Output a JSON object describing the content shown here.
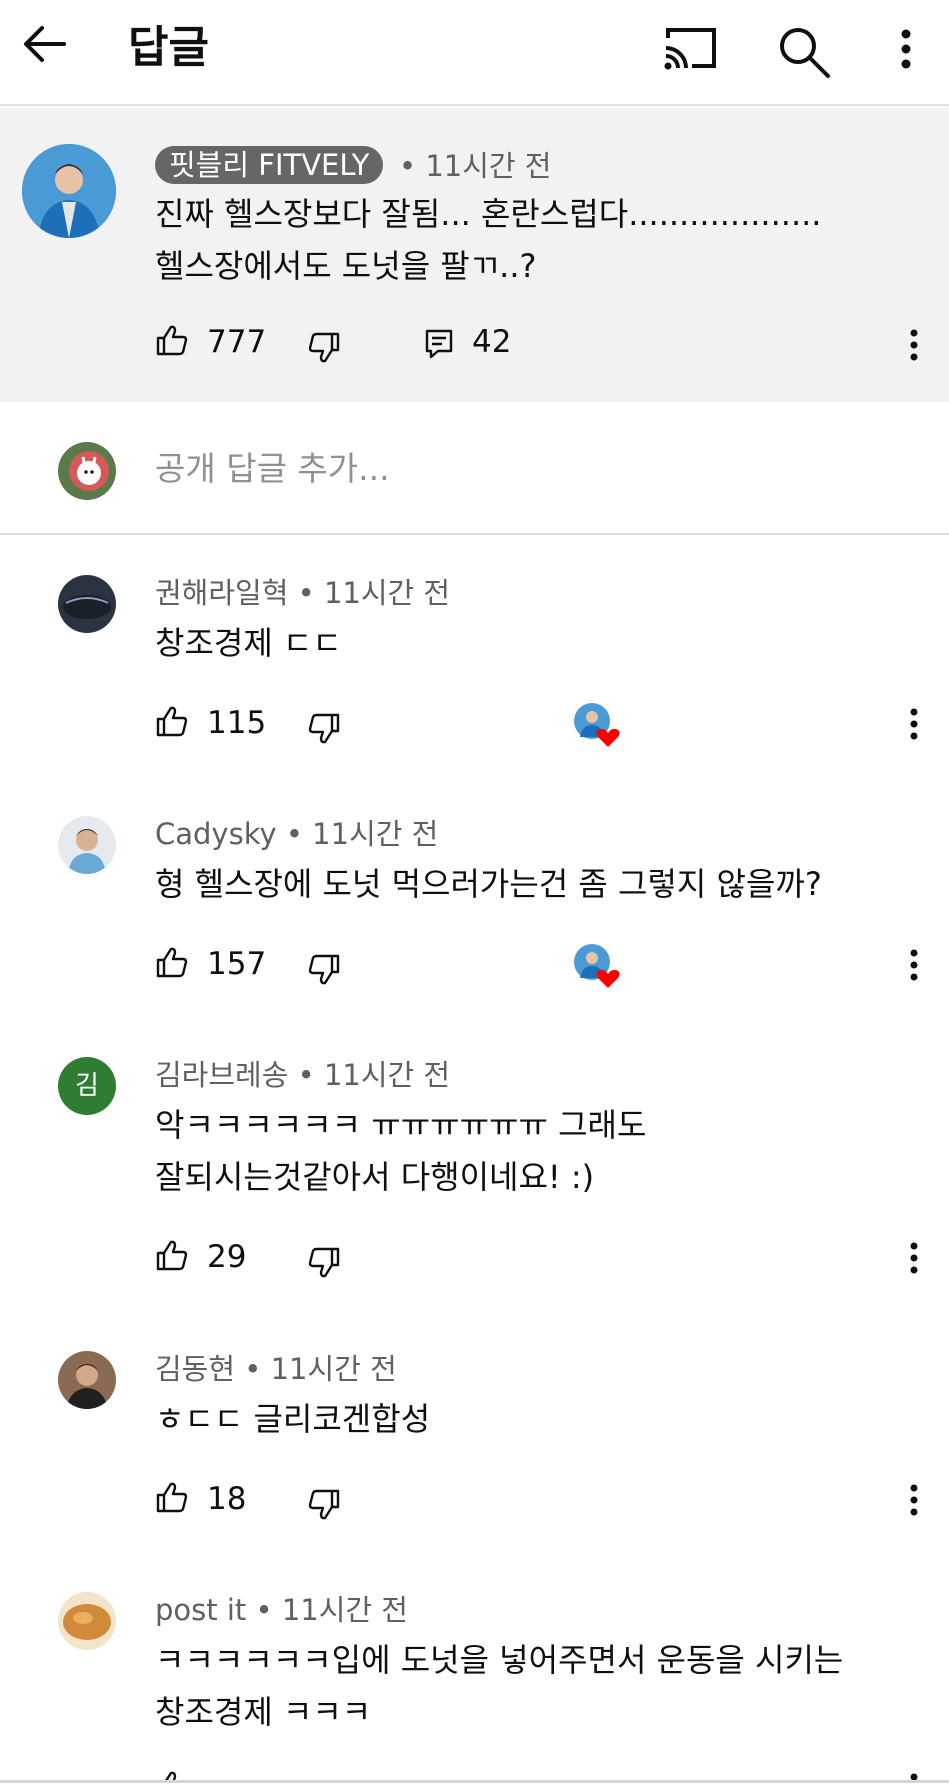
{
  "header": {
    "title": "답글"
  },
  "parent": {
    "author": "핏블리 FITVELY",
    "time": "• 11시간 전",
    "lines": [
      "진짜 헬스장보다 잘됨... 혼란스럽다...................",
      "헬스장에서도 도넛을 팔ㄲ..?"
    ],
    "likes": "777",
    "replies": "42"
  },
  "composer": {
    "placeholder": "공개 답글 추가..."
  },
  "comments": [
    {
      "author": "권해라일혁",
      "time": "• 11시간 전",
      "lines": [
        "창조경제 ㄷㄷ"
      ],
      "likes": "115",
      "hearted": true
    },
    {
      "author": "Cadysky",
      "time": "• 11시간 전",
      "lines": [
        "형 헬스장에 도넛 먹으러가는건 좀 그렇지 않을까?"
      ],
      "likes": "157",
      "hearted": true
    },
    {
      "author": "김라브레송",
      "time": "• 11시간 전",
      "lines": [
        "악ㅋㅋㅋㅋㅋㅋ ㅠㅠㅠㅠㅠㅠ 그래도",
        "잘되시는것같아서 다행이네요! :)"
      ],
      "likes": "29",
      "avatar_letter": "김"
    },
    {
      "author": "김동현",
      "time": "• 11시간 전",
      "lines": [
        "ㅎㄷㄷ 글리코겐합성"
      ],
      "likes": "18"
    },
    {
      "author": "post it",
      "time": "• 11시간 전",
      "lines": [
        "ㅋㅋㅋㅋㅋㅋ입에 도넛을 넣어주면서 운동을 시키는",
        "창조경제 ㅋㅋㅋ"
      ],
      "likes": ""
    }
  ],
  "icons": [
    "back-arrow-icon",
    "cast-icon",
    "search-icon",
    "more-vert-icon",
    "thumbs-up-icon",
    "thumbs-down-icon",
    "reply-icon",
    "heart-icon"
  ],
  "colors": {
    "parent_bg": "#f2f2f2",
    "owner_chip": "#666666",
    "heart": "#ff0000",
    "letter_avatar": "#2e7d32"
  }
}
